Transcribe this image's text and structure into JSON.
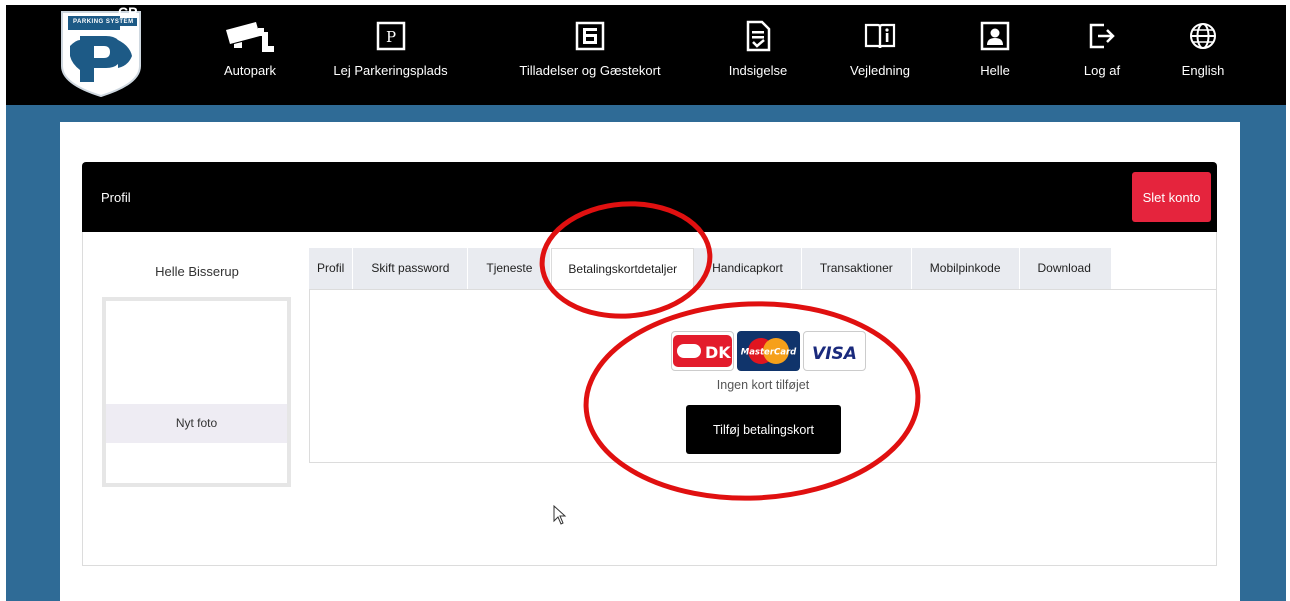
{
  "brand": {
    "logo_top": "CP",
    "logo_band": "PARKING SYSTEM"
  },
  "nav": [
    {
      "label": "Autopark",
      "icon": "camera-icon"
    },
    {
      "label": "Lej Parkeringsplads",
      "icon": "parking-icon"
    },
    {
      "label": "Tilladelser og Gæstekort",
      "icon": "permit-icon"
    },
    {
      "label": "Indsigelse",
      "icon": "document-check-icon"
    },
    {
      "label": "Vejledning",
      "icon": "guide-book-icon"
    },
    {
      "label": "Helle",
      "icon": "user-icon"
    },
    {
      "label": "Log af",
      "icon": "logout-icon"
    },
    {
      "label": "English",
      "icon": "globe-icon"
    }
  ],
  "profile": {
    "header_title": "Profil",
    "delete_label": "Slet konto",
    "user_name": "Helle Bisserup",
    "new_photo_label": "Nyt foto"
  },
  "tabs": [
    {
      "label": "Profil"
    },
    {
      "label": "Skift password"
    },
    {
      "label": "Tjeneste"
    },
    {
      "label": "Betalingskortdetaljer",
      "active": true
    },
    {
      "label": "Handicapkort"
    },
    {
      "label": "Transaktioner"
    },
    {
      "label": "Mobilpinkode"
    },
    {
      "label": "Download"
    }
  ],
  "payment": {
    "card_logos": [
      "DK",
      "MasterCard",
      "VISA"
    ],
    "no_cards_text": "Ingen kort tilføjet",
    "add_card_label": "Tilføj betalingskort"
  },
  "colors": {
    "topbar": "#000000",
    "band": "#2f6b96",
    "danger": "#e5243d",
    "annotation": "#e01010"
  }
}
